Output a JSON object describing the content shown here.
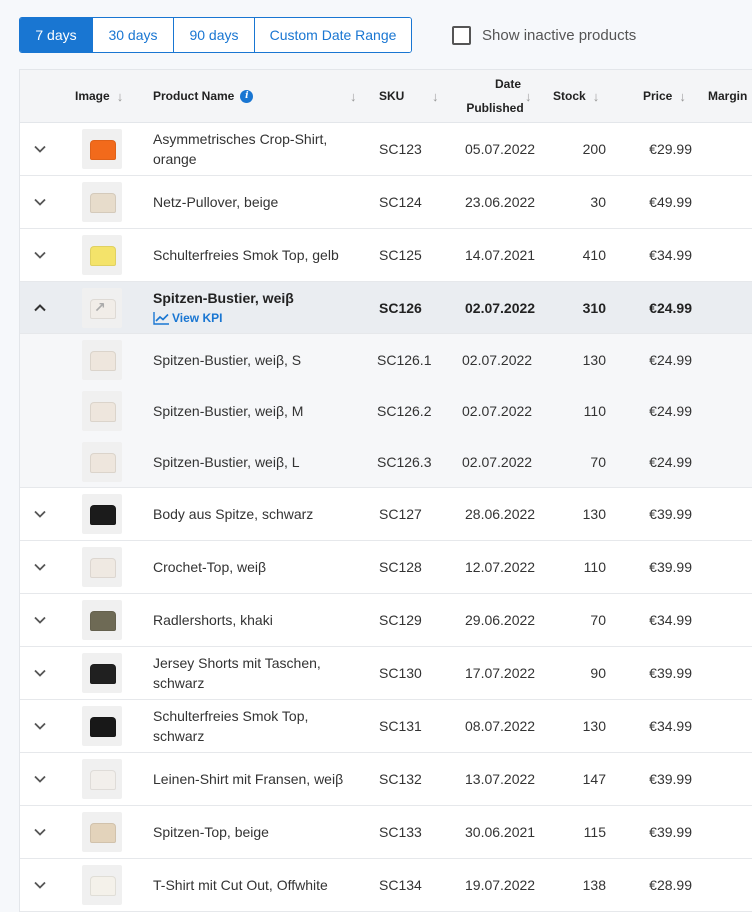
{
  "filters": {
    "ranges": [
      {
        "label": "7 days",
        "active": true
      },
      {
        "label": "30 days",
        "active": false
      },
      {
        "label": "90 days",
        "active": false
      },
      {
        "label": "Custom Date Range",
        "active": false
      }
    ],
    "show_inactive_label": "Show inactive products"
  },
  "columns": {
    "image": "Image",
    "product_name": "Product Name",
    "sku": "SKU",
    "date_published_1": "Date",
    "date_published_2": "Published",
    "stock": "Stock",
    "price": "Price",
    "margin": "Margin"
  },
  "view_kpi_label": "View KPI",
  "rows": [
    {
      "name": "Asymmetrisches Crop-Shirt, orange",
      "sku": "SC123",
      "date": "05.07.2022",
      "stock": "200",
      "price": "€29.99",
      "thumb_color": "#f26a1b"
    },
    {
      "name": "Netz-Pullover, beige",
      "sku": "SC124",
      "date": "23.06.2022",
      "stock": "30",
      "price": "€49.99",
      "thumb_color": "#e7dccb"
    },
    {
      "name": "Schulterfreies Smok Top, gelb",
      "sku": "SC125",
      "date": "14.07.2021",
      "stock": "410",
      "price": "€34.99",
      "thumb_color": "#f4e36a"
    },
    {
      "name": "Spitzen-Bustier, weiβ",
      "sku": "SC126",
      "date": "02.07.2022",
      "stock": "310",
      "price": "€24.99",
      "thumb_color": "#f1ede8",
      "expanded": true
    },
    {
      "name": "Spitzen-Bustier, weiβ, S",
      "sku": "SC126.1",
      "date": "02.07.2022",
      "stock": "130",
      "price": "€24.99",
      "thumb_color": "#eee6dd",
      "variant": true
    },
    {
      "name": "Spitzen-Bustier, weiβ, M",
      "sku": "SC126.2",
      "date": "02.07.2022",
      "stock": "110",
      "price": "€24.99",
      "thumb_color": "#eee6dd",
      "variant": true
    },
    {
      "name": "Spitzen-Bustier, weiβ, L",
      "sku": "SC126.3",
      "date": "02.07.2022",
      "stock": "70",
      "price": "€24.99",
      "thumb_color": "#eee6dd",
      "variant": true
    },
    {
      "name": "Body aus Spitze, schwarz",
      "sku": "SC127",
      "date": "28.06.2022",
      "stock": "130",
      "price": "€39.99",
      "thumb_color": "#1b1b1b"
    },
    {
      "name": "Crochet-Top, weiβ",
      "sku": "SC128",
      "date": "12.07.2022",
      "stock": "110",
      "price": "€39.99",
      "thumb_color": "#efe9e2"
    },
    {
      "name": "Radlershorts, khaki",
      "sku": "SC129",
      "date": "29.06.2022",
      "stock": "70",
      "price": "€34.99",
      "thumb_color": "#6e6a55"
    },
    {
      "name": "Jersey Shorts mit Taschen, schwarz",
      "sku": "SC130",
      "date": "17.07.2022",
      "stock": "90",
      "price": "€39.99",
      "thumb_color": "#202020"
    },
    {
      "name": "Schulterfreies Smok Top, schwarz",
      "sku": "SC131",
      "date": "08.07.2022",
      "stock": "130",
      "price": "€34.99",
      "thumb_color": "#181818"
    },
    {
      "name": "Leinen-Shirt mit Fransen, weiβ",
      "sku": "SC132",
      "date": "13.07.2022",
      "stock": "147",
      "price": "€39.99",
      "thumb_color": "#f2efeb"
    },
    {
      "name": "Spitzen-Top, beige",
      "sku": "SC133",
      "date": "30.06.2021",
      "stock": "115",
      "price": "€39.99",
      "thumb_color": "#e3d3bb"
    },
    {
      "name": "T-Shirt mit Cut Out, Offwhite",
      "sku": "SC134",
      "date": "19.07.2022",
      "stock": "138",
      "price": "€28.99",
      "thumb_color": "#f4f1ea"
    }
  ]
}
